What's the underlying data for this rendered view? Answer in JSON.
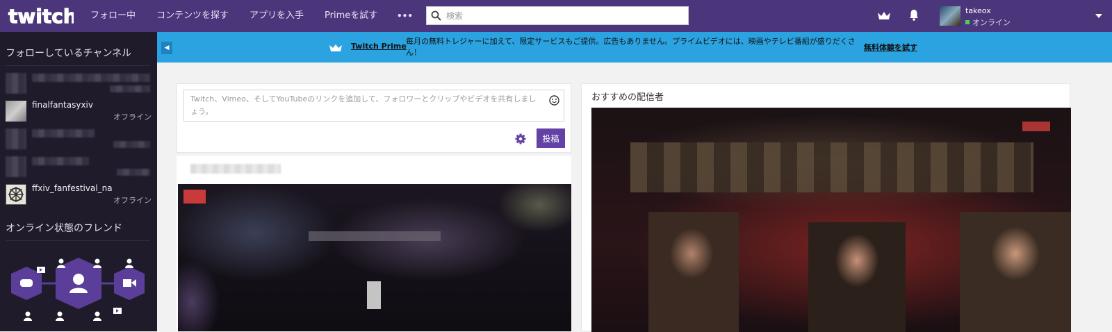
{
  "header": {
    "logo": "twitch",
    "nav": [
      "フォロー中",
      "コンテンツを探す",
      "アプリを入手",
      "Primeを試す"
    ],
    "more": "•••",
    "search_placeholder": "検索",
    "user": {
      "name": "takeox",
      "status": "オンライン"
    }
  },
  "sidebar": {
    "following_title": "フォローしているチャンネル",
    "channels": [
      {
        "name": "",
        "status": ""
      },
      {
        "name": "finalfantasyxiv",
        "status": "オフライン"
      },
      {
        "name": "",
        "status": ""
      },
      {
        "name": "",
        "status": ""
      },
      {
        "name": "ffxiv_fanfestival_na",
        "status": "オフライン"
      }
    ],
    "friends_title": "オンライン状態のフレンド"
  },
  "prime_banner": {
    "label": "Twitch Prime",
    "text": "毎月の無料トレジャーに加えて、限定サービスもご提供。広告もありません。プライムビデオには、映画やテレビ番組が盛りだくさん！",
    "cta": "無料体験を試す"
  },
  "composer": {
    "placeholder": "Twitch、Vimeo、そしてYouTubeのリンクを追加して、フォロワーとクリップやビデオを共有しましょう。",
    "post_label": "投稿"
  },
  "recommended": {
    "title": "おすすめの配信者"
  },
  "colors": {
    "header": "#4b367c",
    "sidebar": "#1f1b2a",
    "prime_banner": "#2ba3e0",
    "accent": "#6441a5"
  }
}
